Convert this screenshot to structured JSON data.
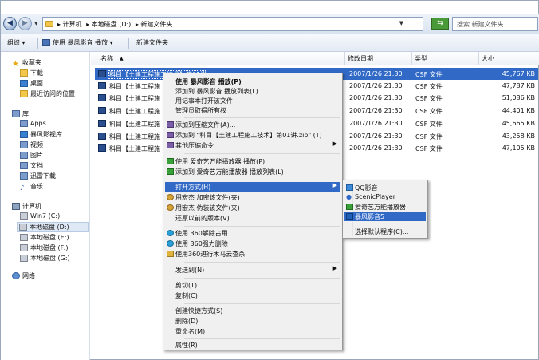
{
  "window": {
    "title": "新建文件夹"
  },
  "address": {
    "crumbs": [
      "▸ 计算机",
      "▸ 本地磁盘 (D:)",
      "▸ 新建文件夹"
    ],
    "search_placeholder": "搜索 新建文件夹"
  },
  "toolbar": {
    "organize": "组织 ▾",
    "play_with": "使用 暴风影音 播放 ▾",
    "new_folder": "新建文件夹"
  },
  "sidebar": {
    "favorites": "收藏夹",
    "fav_items": [
      "下载",
      "桌面",
      "最近访问的位置"
    ],
    "library": "库",
    "lib_items": [
      "Apps",
      "暴风影视库",
      "视频",
      "图片",
      "文档",
      "迅雷下载",
      "音乐"
    ],
    "computer": "计算机",
    "drives": [
      "Win7 (C:)",
      "本地磁盘 (D:)",
      "本地磁盘 (E:)",
      "本地磁盘 (F:)",
      "本地磁盘 (G:)"
    ],
    "network": "网络"
  },
  "columns": {
    "name": "名称",
    "date": "修改日期",
    "type": "类型",
    "size": "大小"
  },
  "files": [
    {
      "name": "科目【土建工程施工技术】第01讲",
      "date": "2007/1/26 21:30",
      "type": "CSF 文件",
      "size": "45,767 KB"
    },
    {
      "name": "科目【土建工程施",
      "date": "2007/1/26 21:30",
      "type": "CSF 文件",
      "size": "47,787 KB"
    },
    {
      "name": "科目【土建工程施",
      "date": "2007/1/26 21:30",
      "type": "CSF 文件",
      "size": "51,086 KB"
    },
    {
      "name": "科目【土建工程施",
      "date": "2007/1/26 21:30",
      "type": "CSF 文件",
      "size": "44,401 KB"
    },
    {
      "name": "科目【土建工程施",
      "date": "2007/1/26 21:30",
      "type": "CSF 文件",
      "size": "45,665 KB"
    },
    {
      "name": "科目【土建工程施",
      "date": "2007/1/26 21:30",
      "type": "CSF 文件",
      "size": "43,258 KB"
    },
    {
      "name": "科目【土建工程施",
      "date": "2007/1/26 21:30",
      "type": "CSF 文件",
      "size": "47,105 KB"
    }
  ],
  "context_menu": {
    "items": [
      "使用 暴风影音 播放(P)",
      "添加到 暴风影音 播放列表(L)",
      "用记事本打开该文件",
      "管理员取得所有权",
      "添加到压缩文件(A)...",
      "添加到 \"科目【土建工程施工技术】第01讲.zip\" (T)",
      "其他压缩命令",
      "使用 爱奇艺万能播放器 播放(P)",
      "添加到 爱奇艺万能播放器 播放列表(L)",
      "打开方式(H)",
      "用宏杰 加密该文件(夹)",
      "用宏杰 伪装该文件(夹)",
      "还原以前的版本(V)",
      "使用 360解除占用",
      "使用 360强力删除",
      "使用360进行木马云查杀",
      "发送到(N)",
      "剪切(T)",
      "复制(C)",
      "创建快捷方式(S)",
      "删除(D)",
      "重命名(M)",
      "属性(R)"
    ]
  },
  "open_with_menu": {
    "items": [
      "QQ影音",
      "ScenicPlayer",
      "爱奇艺万能播放器",
      "暴风影音5",
      "选择默认程序(C)..."
    ]
  },
  "colors": {
    "highlight": "#3169c6",
    "menu_bg": "#f0f0f0"
  }
}
